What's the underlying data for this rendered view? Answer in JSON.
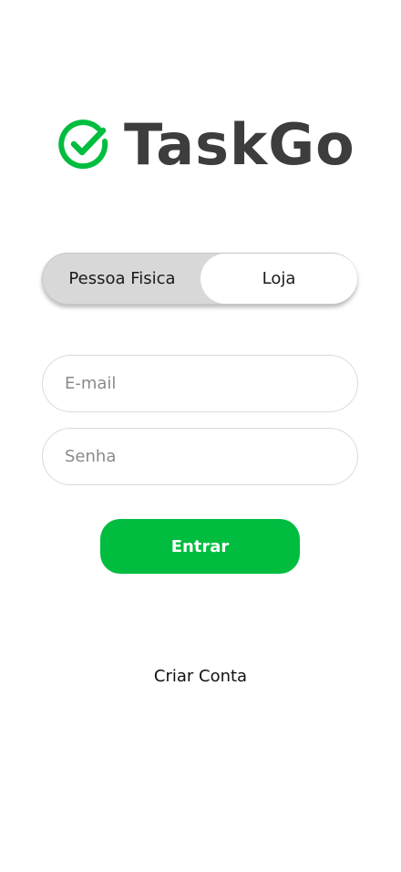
{
  "app": {
    "name": "TaskGo",
    "brand_color": "#00BD3F",
    "logo_icon": "check-circle-icon"
  },
  "account_type": {
    "options": [
      "Pessoa Fisica",
      "Loja"
    ],
    "selected": "Loja"
  },
  "form": {
    "email_placeholder": "E-mail",
    "email_value": "",
    "password_placeholder": "Senha",
    "password_value": ""
  },
  "actions": {
    "login_label": "Entrar",
    "create_account_label": "Criar Conta"
  }
}
